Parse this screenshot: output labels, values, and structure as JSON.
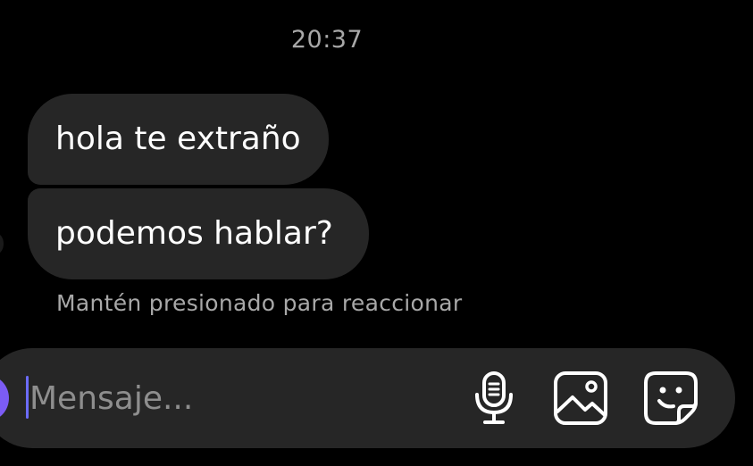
{
  "thread": {
    "timestamp": "20:37",
    "messages": [
      {
        "text": "hola te extraño"
      },
      {
        "text": "podemos hablar?"
      }
    ],
    "reaction_hint": "Mantén presionado para reaccionar"
  },
  "composer": {
    "placeholder": "Mensaje...",
    "value": "",
    "icons": {
      "microphone": "microphone-icon",
      "gallery": "gallery-icon",
      "sticker": "sticker-icon"
    }
  },
  "colors": {
    "background": "#000000",
    "bubble": "#262626",
    "composer": "#262626",
    "muted_text": "#a8a8a8",
    "placeholder_text": "#8e8e8e",
    "cursor": "#6c6cff",
    "camera_button": "#7c5cf5"
  }
}
